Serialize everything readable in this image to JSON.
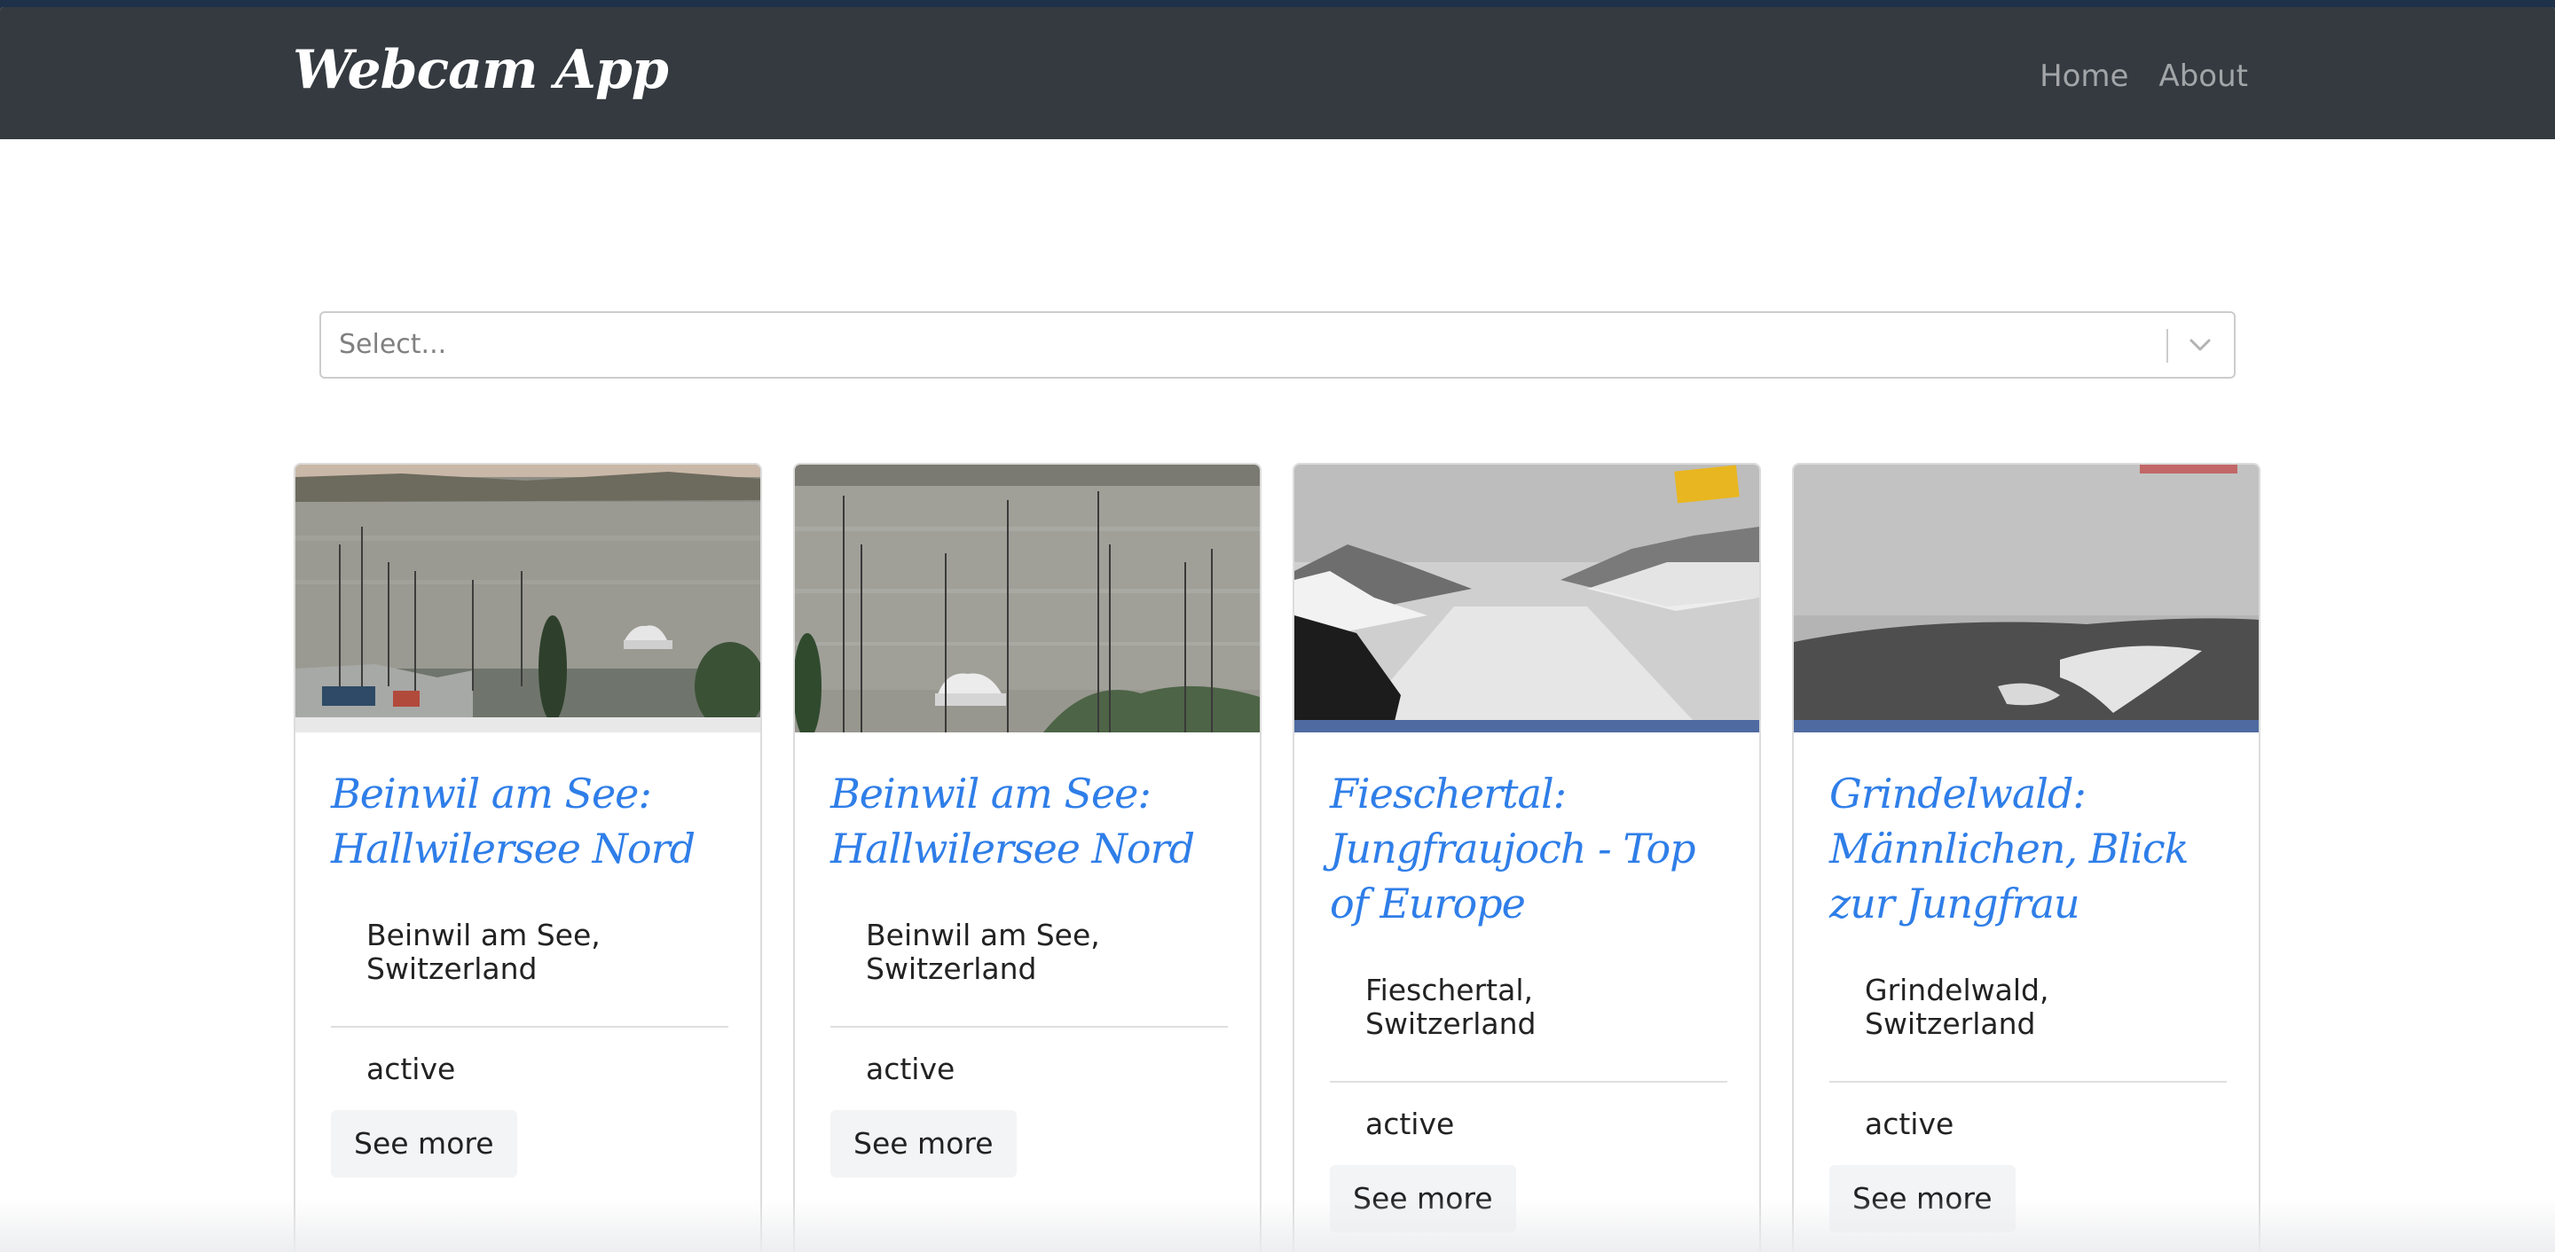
{
  "navbar": {
    "brand": "Webcam App",
    "links": [
      {
        "label": "Home"
      },
      {
        "label": "About"
      }
    ]
  },
  "filter": {
    "placeholder": "Select..."
  },
  "cards": [
    {
      "title": "Beinwil am See: Hallwilersee Nord",
      "location": "Beinwil am See, Switzerland",
      "status": "active",
      "button": "See more",
      "image": "lake-harbor-boats"
    },
    {
      "title": "Beinwil am See: Hallwilersee Nord",
      "location": "Beinwil am See, Switzerland",
      "status": "active",
      "button": "See more",
      "image": "lake-harbor-boats"
    },
    {
      "title": "Fieschertal: Jungfraujoch - Top of Europe",
      "location": "Fieschertal, Switzerland",
      "status": "active",
      "button": "See more",
      "image": "glacier-snow-valley"
    },
    {
      "title": "Grindelwald: Männlichen, Blick zur Jungfrau",
      "location": "Grindelwald, Switzerland",
      "status": "active",
      "button": "See more",
      "image": "foggy-mountain-slope"
    }
  ],
  "colors": {
    "navbar": "#343a40",
    "title": "#2f7ee8",
    "nav_link": "#a2a5a8"
  }
}
